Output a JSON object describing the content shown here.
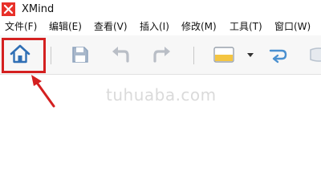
{
  "window": {
    "title": "XMind",
    "logo_color": "#e8312a"
  },
  "menu": {
    "items": [
      {
        "label": "文件(F)"
      },
      {
        "label": "编辑(E)"
      },
      {
        "label": "查看(V)"
      },
      {
        "label": "插入(I)"
      },
      {
        "label": "修改(M)"
      },
      {
        "label": "工具(T)"
      },
      {
        "label": "窗口(W)"
      }
    ]
  },
  "toolbar": {
    "buttons": [
      {
        "icon": "home-icon"
      },
      {
        "icon": "save-icon"
      },
      {
        "icon": "undo-icon"
      },
      {
        "icon": "redo-icon"
      },
      {
        "icon": "topic-style-icon"
      },
      {
        "icon": "dropdown-arrow-icon"
      },
      {
        "icon": "relationship-icon"
      },
      {
        "icon": "boundary-icon"
      }
    ],
    "highlight_color": "#d42020",
    "accent_colors": {
      "home": "#2f6fb5",
      "save": "#8ea3bd",
      "disabled": "#b9bec6",
      "topic_fill": "#f4c542",
      "relationship": "#4a90d0"
    }
  },
  "watermark": {
    "text": "tuhuaba.com"
  }
}
